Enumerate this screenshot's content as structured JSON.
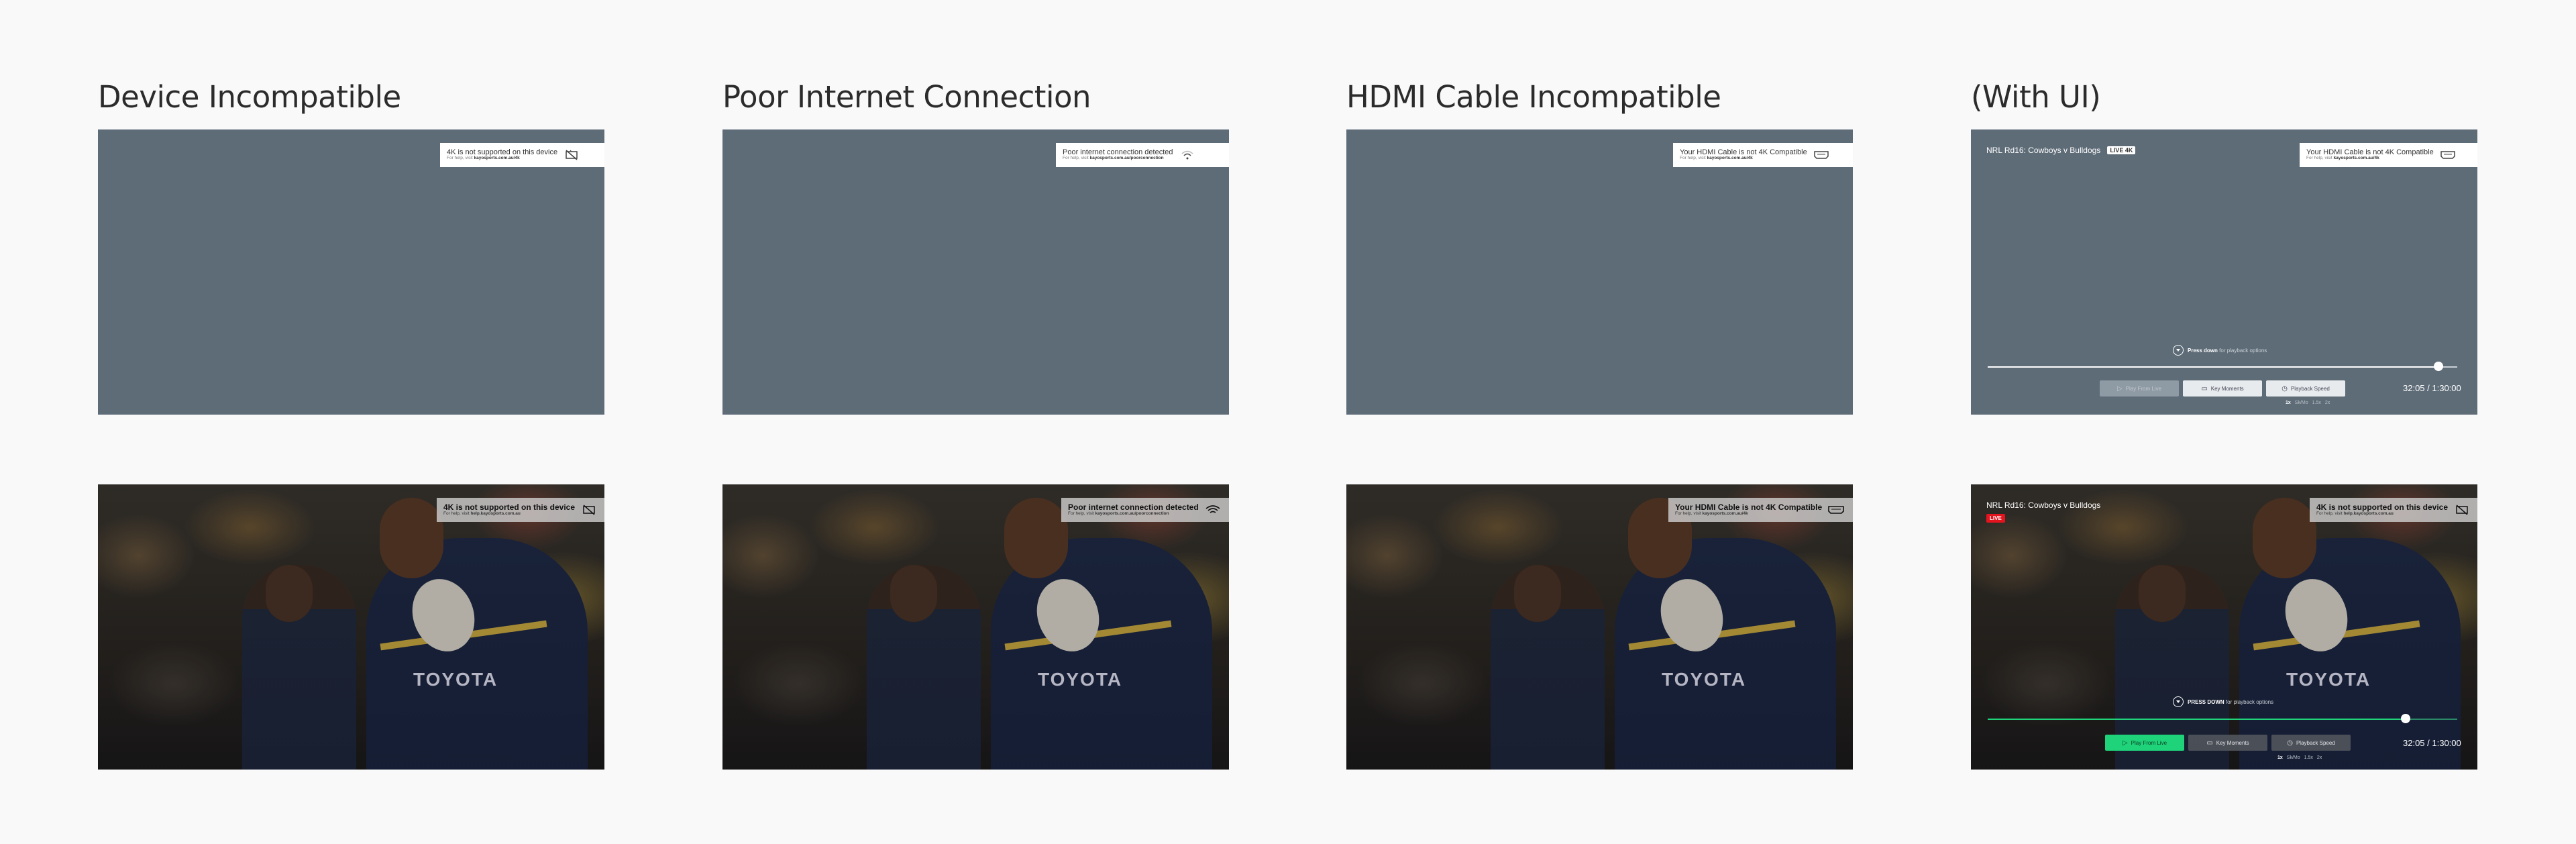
{
  "columns": [
    {
      "title": "Device Incompatible"
    },
    {
      "title": "Poor Internet Connection"
    },
    {
      "title": "HDMI Cable Incompatible"
    },
    {
      "title": "(With UI)"
    }
  ],
  "toasts": {
    "device_light": {
      "line1": "4K is not supported on this device",
      "help_prefix": "For help, visit ",
      "help_link": "kayosports.com.au/4k",
      "icon": "tv-crossed-icon"
    },
    "internet_light": {
      "line1": "Poor internet connection detected",
      "help_prefix": "For help, visit ",
      "help_link": "kayosports.com.au/poorconnection",
      "icon": "wifi-weak-icon"
    },
    "hdmi_light": {
      "line1": "Your HDMI Cable is not 4K Compatible",
      "help_prefix": "For help, visit ",
      "help_link": "kayosports.com.au/4k",
      "icon": "hdmi-icon"
    },
    "hdmi_ui_light": {
      "line1": "Your HDMI Cable is not 4K Compatible",
      "help_prefix": "For help, visit ",
      "help_link": "kayosports.com.au/4k",
      "icon": "hdmi-icon"
    },
    "device_dark": {
      "line1": "4K is not supported on this device",
      "help_prefix": "For help, visit ",
      "help_link": "help.kayosports.com.au",
      "icon": "tv-crossed-icon"
    },
    "internet_dark": {
      "line1": "Poor internet connection detected",
      "help_prefix": "For help, visit ",
      "help_link": "kayosports.com.au/poorconnection",
      "icon": "wifi-weak-icon"
    },
    "hdmi_dark": {
      "line1": "Your HDMI Cable is not 4K Compatible",
      "help_prefix": "For help, visit ",
      "help_link": "kayosports.com.au/4k",
      "icon": "hdmi-icon"
    },
    "device_ui_dark": {
      "line1": "4K is not supported on this device",
      "help_prefix": "For help, visit ",
      "help_link": "help.kayosports.com.au",
      "icon": "tv-crossed-icon"
    }
  },
  "player_ui_top": {
    "title": "NRL Rd16: Cowboys v Bulldogs",
    "badge": "LIVE 4K",
    "prompt_main": "Press down",
    "prompt_sub": "for playback options",
    "buttons": [
      "Play From Live",
      "Key Moments",
      "Playback Speed"
    ],
    "time": "32:05 / 1:30:00",
    "speeds": [
      "1x",
      "Sk/Mo",
      "1.5x",
      "2x"
    ],
    "progress": 0.96
  },
  "player_ui_bottom": {
    "title": "NRL Rd16: Cowboys v Bulldogs",
    "badge": "LIVE",
    "prompt_main": "PRESS DOWN",
    "prompt_sub": "for playback options",
    "buttons": [
      "Play From Live",
      "Key Moments",
      "Playback Speed"
    ],
    "time": "32:05 / 1:30:00",
    "speeds": [
      "1x",
      "Sk/Mo",
      "1.5x",
      "2x"
    ],
    "progress": 0.89
  },
  "photo_logo_text": "TOYOTA",
  "colors": {
    "grey_panel": "#5e6c78",
    "live_red": "#e3141e",
    "accent_green": "#1fd37a",
    "page_bg": "#f9f9f9"
  }
}
